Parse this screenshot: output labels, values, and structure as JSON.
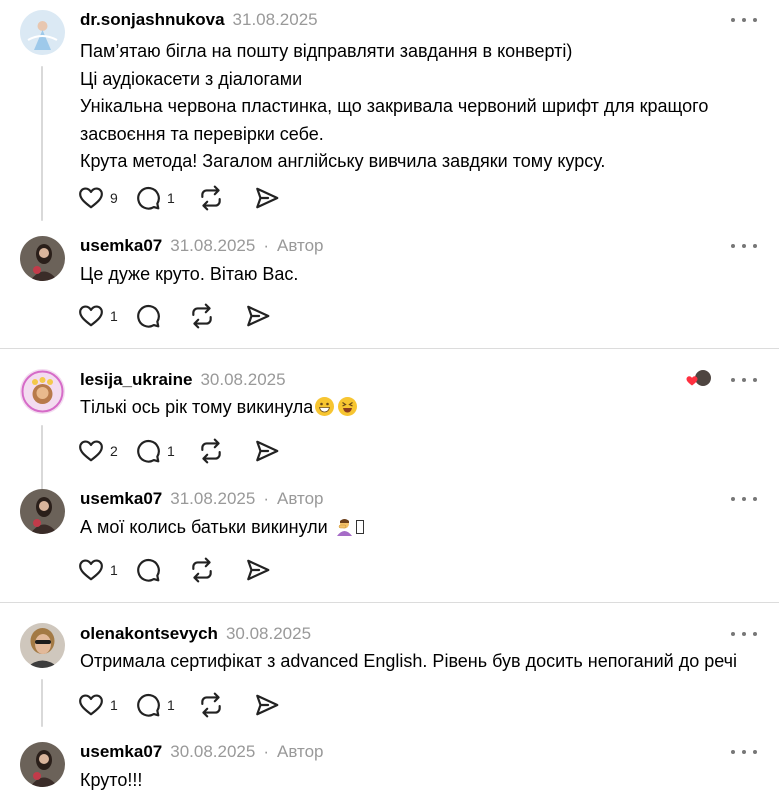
{
  "threads": [
    {
      "comment": {
        "username": "dr.sonjashnukova",
        "date": "31.08.2025",
        "lines": [
          "Пам’ятаю бігла на пошту відправляти завдання в конверті)",
          "Ці аудіокасети з діалогами",
          "Унікальна червона пластинка, що закривала червоний шрифт для кращого",
          "засвоєння та перевірки себе.",
          "Крута метода! Загалом англійську вивчила завдяки тому курсу."
        ],
        "likes": "9",
        "replies": "1"
      },
      "reply": {
        "username": "usemka07",
        "date": "31.08.2025",
        "author_label": "Автор",
        "separator": "·",
        "text": "Це дуже круто. Вітаю Вас.",
        "likes": "1"
      }
    },
    {
      "comment": {
        "username": "lesija_ukraine",
        "date": "30.08.2025",
        "text": "Тількі ось рік тому викинула",
        "emojis": [
          "grinning-face-emoji",
          "laughing-squinting-face-emoji"
        ],
        "likes": "2",
        "replies": "1",
        "liked_by_author": true
      },
      "reply": {
        "username": "usemka07",
        "date": "31.08.2025",
        "author_label": "Автор",
        "separator": "·",
        "text": "А мої колись батьки викинули",
        "emojis": [
          "person-facepalming-emoji",
          "missing-glyph-box"
        ],
        "likes": "1"
      }
    },
    {
      "comment": {
        "username": "olenakontsevych",
        "date": "30.08.2025",
        "text": "Отримала сертифікат з advanced English. Рівень був досить непоганий до речі",
        "likes": "1",
        "replies": "1"
      },
      "reply": {
        "username": "usemka07",
        "date": "30.08.2025",
        "author_label": "Автор",
        "separator": "·",
        "text": "Круто!!!"
      }
    }
  ],
  "colors": {
    "text": "#000000",
    "muted": "#999999",
    "icon": "#333333",
    "divider": "#dcdcdc",
    "thread_line": "#d9d9d9",
    "heart_red": "#ff3040"
  },
  "icons": {
    "like": "heart-outline-icon",
    "reply": "speech-bubble-icon",
    "repost": "repost-arrows-icon",
    "share": "paper-plane-icon",
    "more": "more-dots-icon"
  }
}
